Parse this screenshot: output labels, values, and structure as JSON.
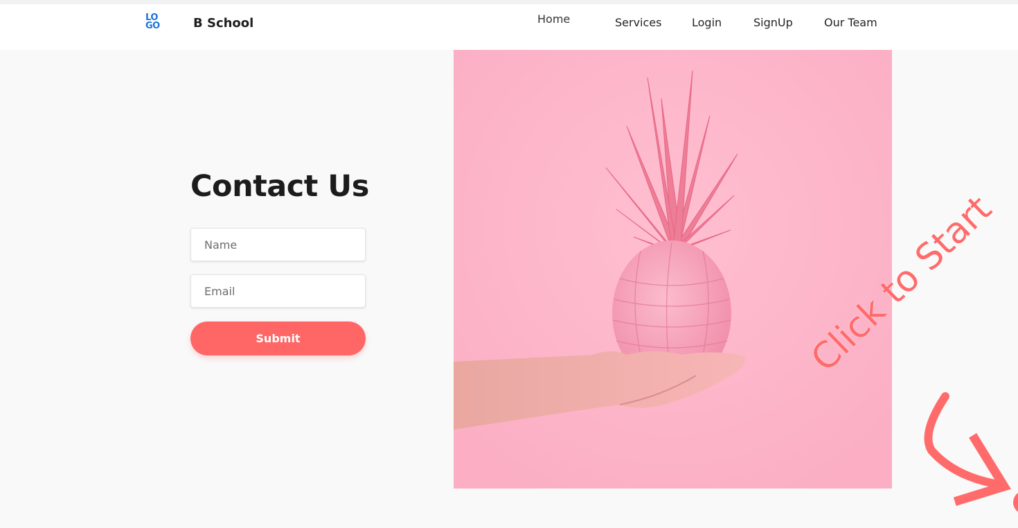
{
  "header": {
    "logo_text_top": "LO",
    "logo_text_bottom": "GO",
    "brand": "B School",
    "nav": {
      "home": "Home",
      "services": "Services",
      "login": "Login",
      "signup": "SignUp",
      "team": "Our Team"
    }
  },
  "contact": {
    "title": "Contact Us",
    "name_placeholder": "Name",
    "email_placeholder": "Email",
    "submit_label": "Submit"
  },
  "overlay": {
    "label": "Click to Start"
  },
  "colors": {
    "accent": "#ff6666",
    "logo": "#1a73d9",
    "photo_bg": "#fdb3c7"
  }
}
